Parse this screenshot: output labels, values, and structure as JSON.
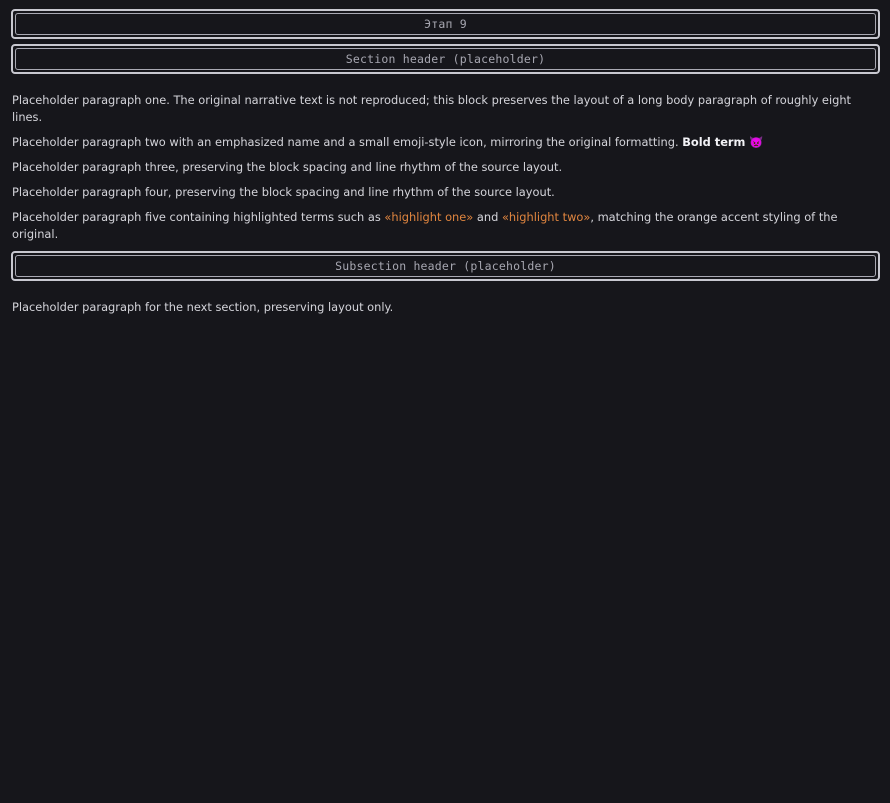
{
  "stage": {
    "title": "Этап 9"
  },
  "event": {
    "title": "Section header (placeholder)"
  },
  "section1": {
    "paragraphs": [
      "Placeholder paragraph one. The original narrative text is not reproduced; this block preserves the layout of a long body paragraph of roughly eight lines.",
      "Placeholder paragraph two with an emphasized name and a small emoji-style icon, mirroring the original formatting.",
      "Placeholder paragraph three, preserving the block spacing and line rhythm of the source layout.",
      "Placeholder paragraph four, preserving the block spacing and line rhythm of the source layout."
    ],
    "para2_bold": "Bold term",
    "para5_a": "Placeholder paragraph five containing highlighted terms such as ",
    "para5_hl1": "«highlight one»",
    "para5_b": " and ",
    "para5_hl2": "«highlight two»",
    "para5_c": ", matching the orange accent styling of the original."
  },
  "subsection": {
    "title": "Subsection header (placeholder)"
  },
  "section2": {
    "paragraphs": [
      "Placeholder paragraph for the next section, preserving layout only."
    ]
  }
}
